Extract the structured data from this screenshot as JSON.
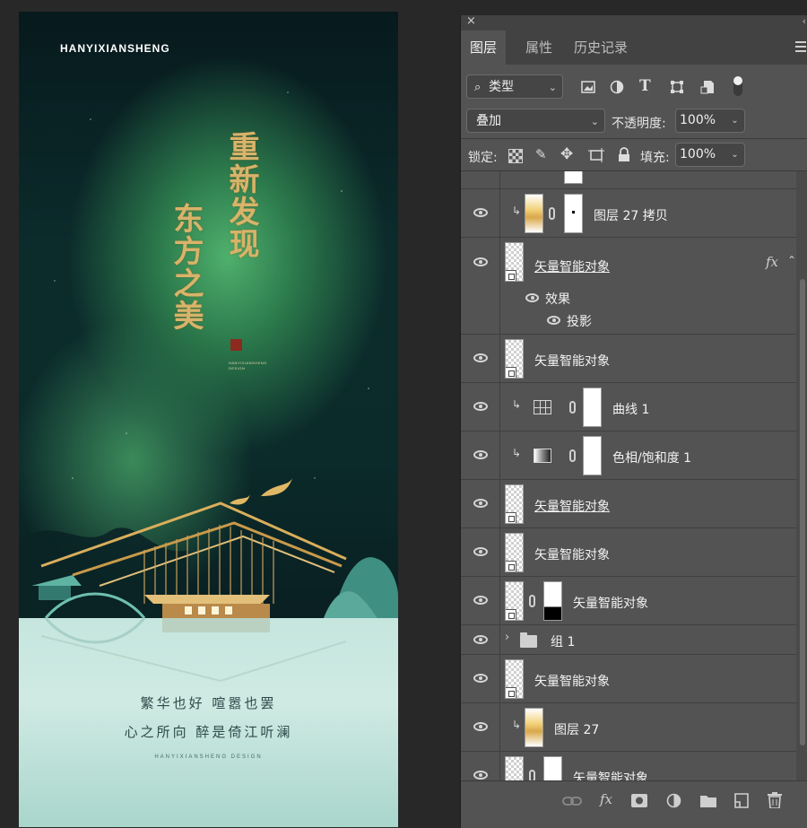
{
  "poster": {
    "brand": "HANYIXIANSHENG",
    "title_right": "重新发现",
    "title_left": "东方之美",
    "seal_caption_1": "HANYIXIANSHENG",
    "seal_caption_2": "DESIGN",
    "verse_1": "繁华也好 喧嚣也罢",
    "verse_2": "心之所向 醉是倚江听澜",
    "design_line": "HANYIXIANSHENG DESIGN",
    "colors": {
      "gold": "#d8b36a",
      "deep_green": "#0b2a2a",
      "aurora_green": "#4fb06d",
      "mint": "#c5e6de"
    }
  },
  "panel": {
    "close_icon": "close-icon",
    "tabs": [
      {
        "label": "图层",
        "active": true
      },
      {
        "label": "属性",
        "active": false
      },
      {
        "label": "历史记录",
        "active": false
      }
    ],
    "filter": {
      "label": "类型",
      "icon": "search-icon"
    },
    "filter_icons": [
      "image-filter-icon",
      "adjustment-filter-icon",
      "type-filter-icon",
      "shape-filter-icon",
      "smart-object-filter-icon",
      "filter-toggle-icon"
    ],
    "blend_mode": "叠加",
    "opacity_label": "不透明度:",
    "opacity_value": "100%",
    "lock_label": "锁定:",
    "lock_icons": [
      "lock-transparent-icon",
      "lock-pixels-icon",
      "lock-position-icon",
      "lock-artboard-icon",
      "lock-all-icon"
    ],
    "fill_label": "填充:",
    "fill_value": "100%",
    "layers": [
      {
        "name": "图层 27 拷贝",
        "type": "pixel-clipped-mask",
        "visible": true
      },
      {
        "name": "矢量智能对象",
        "type": "smart-object",
        "visible": true,
        "underline": true,
        "fx": "fx"
      },
      {
        "name": "效果",
        "type": "effect-group",
        "visible": true
      },
      {
        "name": "投影",
        "type": "effect",
        "visible": true
      },
      {
        "name": "矢量智能对象",
        "type": "smart-object",
        "visible": true
      },
      {
        "name": "曲线 1",
        "type": "curves",
        "visible": true
      },
      {
        "name": "色相/饱和度 1",
        "type": "hue-saturation",
        "visible": true
      },
      {
        "name": "矢量智能对象",
        "type": "smart-object",
        "visible": true,
        "underline": true
      },
      {
        "name": "矢量智能对象",
        "type": "smart-object",
        "visible": true
      },
      {
        "name": "矢量智能对象",
        "type": "smart-object-mask",
        "visible": true
      },
      {
        "name": "组 1",
        "type": "group",
        "visible": true
      },
      {
        "name": "矢量智能对象",
        "type": "smart-object",
        "visible": true
      },
      {
        "name": "图层 27",
        "type": "pixel-clipped",
        "visible": true
      },
      {
        "name": "矢量智能对象",
        "type": "smart-object-mask",
        "visible": true,
        "underline": true
      }
    ],
    "bottom_icons": [
      "link-layers-icon",
      "fx-icon",
      "add-mask-icon",
      "adjustment-layer-icon",
      "new-group-icon",
      "new-layer-icon",
      "delete-icon"
    ],
    "fx_glyph": "fx"
  }
}
